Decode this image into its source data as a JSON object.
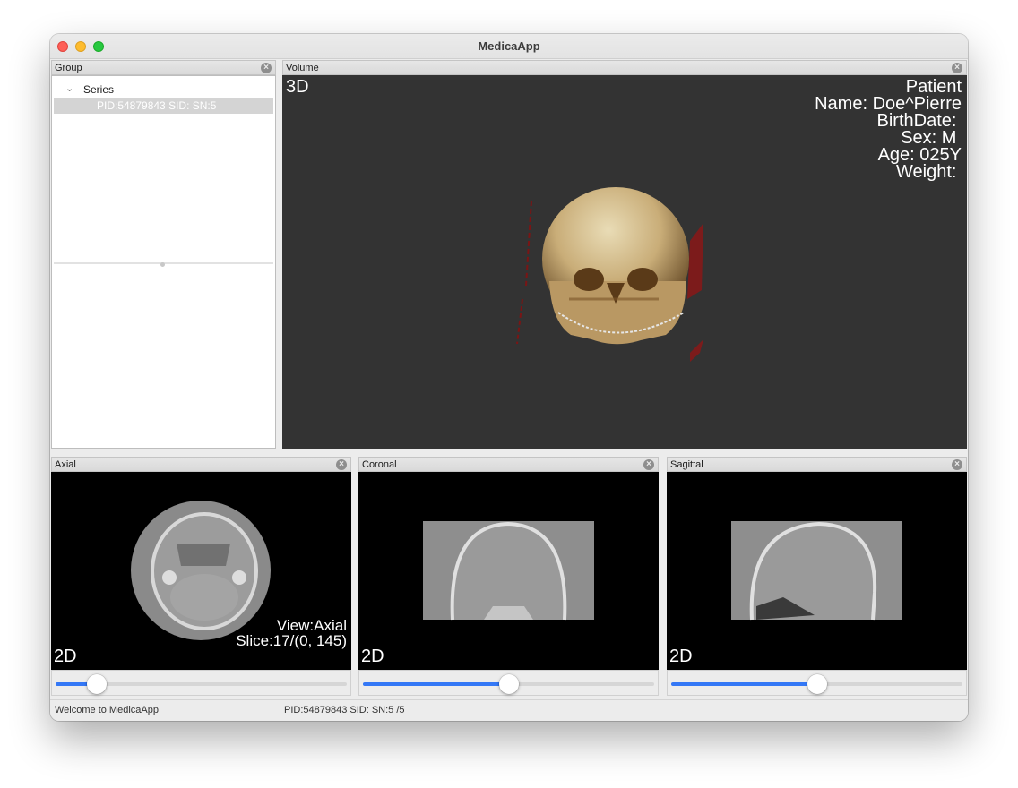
{
  "window": {
    "title": "MedicaApp"
  },
  "group_panel": {
    "title": "Group",
    "tree": {
      "root_label": "Series",
      "selected_item": "PID:54879843 SID: SN:5"
    }
  },
  "volume_panel": {
    "title": "Volume",
    "mode_label": "3D",
    "patient": {
      "heading": "Patient",
      "name": "Name: Doe^Pierre",
      "birthdate": "BirthDate: ",
      "sex": "Sex: M ",
      "age": "Age: 025Y",
      "weight": "Weight: "
    }
  },
  "axial_panel": {
    "title": "Axial",
    "mode_label": "2D",
    "view_label": "View:Axial",
    "slice_label": "Slice:17/(0, 145)",
    "slider_value": 0.14
  },
  "coronal_panel": {
    "title": "Coronal",
    "mode_label": "2D",
    "slider_value": 0.5
  },
  "sagittal_panel": {
    "title": "Sagittal",
    "mode_label": "2D",
    "slider_value": 0.5
  },
  "status_bar": {
    "message": "Welcome to MedicaApp",
    "info": "PID:54879843 SID: SN:5 /5"
  },
  "icons": {
    "close": "close-circle-icon",
    "expand": "chevron-down-icon"
  },
  "colors": {
    "accent": "#3478f6",
    "volume_bg": "#333333",
    "view_bg": "#000000"
  }
}
